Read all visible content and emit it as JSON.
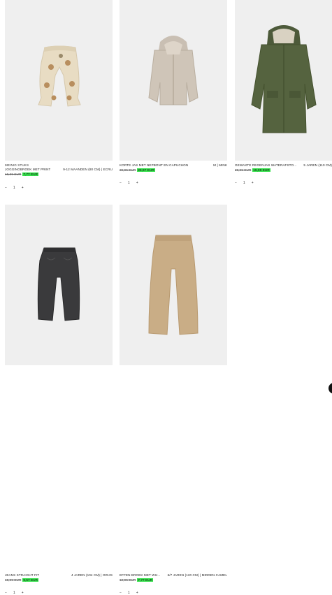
{
  "products": [
    {
      "tag": "MEINIG STUKS",
      "name": "JOGGINGBROEK MET PRINT",
      "size": "9-12 MAANDEN (80 CM) | ECRU",
      "old_price": "10,99 EUR",
      "new_price": "7,77 EUR",
      "stepper": {
        "minus": "−",
        "qty": "1",
        "plus": "+"
      },
      "image": "cream-joggers-with-print"
    },
    {
      "tag": "",
      "name": "KORTE JAS MET NEPBONT EN CAPUCHON",
      "size": "M | MINK",
      "old_price": "39,95 EUR",
      "new_price": "26,97 EUR",
      "stepper": {
        "minus": "−",
        "qty": "1",
        "plus": "+"
      },
      "image": "faux-fur-hooded-jacket"
    },
    {
      "tag": "",
      "name": "GEWAXTE REGENJAS WATERAFSTO...",
      "size": "5 JAREN (110 CM)",
      "old_price": "29,95 EUR",
      "new_price": "15,99 EUR",
      "stepper": {
        "minus": "−",
        "qty": "1",
        "plus": "+"
      },
      "image": "olive-waxed-raincoat"
    },
    {
      "tag": "",
      "name": "JEANS STRAIGHT FIT",
      "size": "4 JAREN (104 CM) | GRIJS",
      "old_price": "15,99 EUR",
      "new_price": "9,57 EUR",
      "stepper": {
        "minus": "−",
        "qty": "1",
        "plus": "+"
      },
      "image": "grey-straight-jeans"
    },
    {
      "tag": "",
      "name": "EFFEN BROEK MET WIJ...",
      "size": "6/7 JAREN (120 CM) | MIDDEN CAMEL",
      "old_price": "12,95 EUR",
      "new_price": "7,77 EUR",
      "stepper": {
        "minus": "−",
        "qty": "1",
        "plus": "+"
      },
      "image": "camel-wide-trousers"
    }
  ],
  "colors": {
    "sale_highlight": "#34e04a",
    "photo_bg": "#efefef"
  }
}
